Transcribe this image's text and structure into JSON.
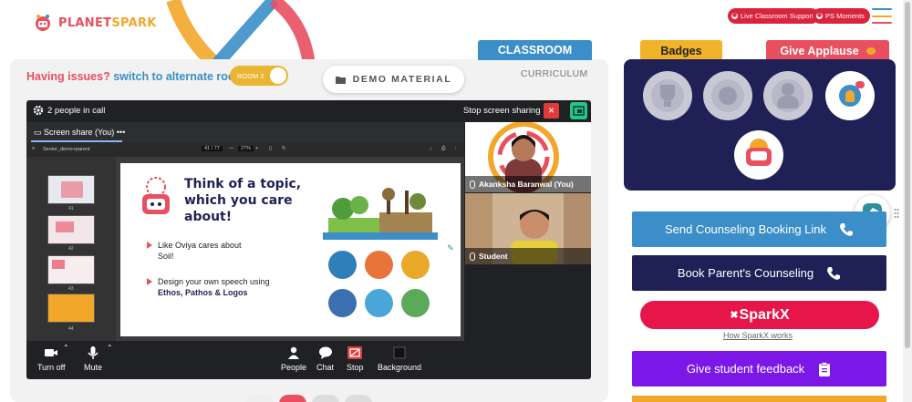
{
  "brand": {
    "name_part1": "PLANET",
    "name_part2": "SPARK"
  },
  "header": {
    "live_support": "Live Classroom Support",
    "ps_moments": "PS Moments"
  },
  "classroom": {
    "tab_classroom": "CLASSROOM",
    "tab_curriculum": "CURRICULUM",
    "issue_text": "Having issues?",
    "issue_link": "switch to alternate room",
    "room_toggle": "ROOM 2",
    "demo_material": "DEMO MATERIAL"
  },
  "meet": {
    "people_in_call": "2 people in call",
    "stop_screen_sharing": "Stop screen sharing",
    "screen_share_tab": "Screen share (You)",
    "more": "•••",
    "doc_name": "Senior_demo+parent",
    "page_indicator": "41 / 77",
    "zoom": "27%",
    "thumb_numbers": [
      "41",
      "42",
      "43",
      "44"
    ],
    "slide": {
      "title": "Think of a topic, which you care about!",
      "bullet1": "Like Oviya cares about Soil!",
      "bullet2_line1": "Design your own speech using",
      "bullet2_line2": "Ethos, Pathos & Logos"
    },
    "participants": [
      {
        "name": "Akanksha Baranwal (You)"
      },
      {
        "name": "Student"
      }
    ],
    "controls": {
      "turn_off": "Turn off",
      "mute": "Mute",
      "people": "People",
      "chat": "Chat",
      "stop": "Stop",
      "background": "Background"
    }
  },
  "right": {
    "tab_badges": "Badges",
    "tab_applause": "Give Applause",
    "send_counseling": "Send Counseling Booking Link",
    "book_parent": "Book Parent's Counseling",
    "sparkx": "SparkX",
    "how_sparkx": "How SparkX works",
    "give_feedback": "Give student feedback"
  },
  "colors": {
    "brand_red": "#e84f5f",
    "brand_yellow": "#f3a72a",
    "blue": "#3b8ec8",
    "navy": "#1f2156",
    "purple": "#7b18e8",
    "sparkx_red": "#e6164a"
  }
}
